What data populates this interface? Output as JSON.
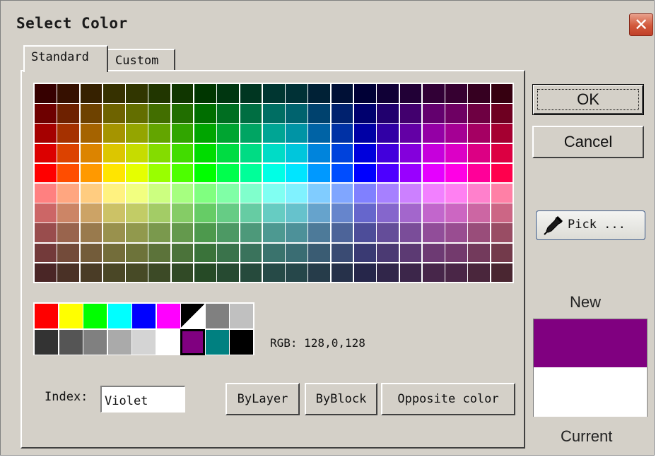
{
  "window": {
    "title": "Select Color",
    "close_glyph": "✕"
  },
  "tabs": [
    {
      "label": "Standard",
      "active": true
    },
    {
      "label": "Custom",
      "active": false
    }
  ],
  "palette": {
    "rows": [
      [
        "#360000",
        "#361000",
        "#362100",
        "#363100",
        "#313600",
        "#213600",
        "#103600",
        "#003600",
        "#003610",
        "#003621",
        "#003631",
        "#003136",
        "#002136",
        "#001036",
        "#000036",
        "#100036",
        "#210036",
        "#310036",
        "#360031",
        "#360021",
        "#360010"
      ],
      [
        "#6e0000",
        "#6e2100",
        "#6e4200",
        "#6e6300",
        "#636e00",
        "#426e00",
        "#216e00",
        "#006e00",
        "#006e21",
        "#006e42",
        "#006e63",
        "#00636e",
        "#00426e",
        "#00216e",
        "#00006e",
        "#21006e",
        "#42006e",
        "#63006e",
        "#6e0063",
        "#6e0042",
        "#6e0021"
      ],
      [
        "#a50000",
        "#a53100",
        "#a56300",
        "#a59400",
        "#94a500",
        "#63a500",
        "#31a500",
        "#00a500",
        "#00a531",
        "#00a563",
        "#00a594",
        "#0094a5",
        "#0063a5",
        "#0031a5",
        "#0000a5",
        "#3100a5",
        "#6300a5",
        "#9400a5",
        "#a50094",
        "#a50063",
        "#a50031"
      ],
      [
        "#dc0000",
        "#dc4200",
        "#dc8400",
        "#dcc600",
        "#c6dc00",
        "#84dc00",
        "#42dc00",
        "#00dc00",
        "#00dc42",
        "#00dc84",
        "#00dcc6",
        "#00c6dc",
        "#0084dc",
        "#0042dc",
        "#0000dc",
        "#4200dc",
        "#8400dc",
        "#c600dc",
        "#dc00c6",
        "#dc0084",
        "#dc0042"
      ],
      [
        "#ff0000",
        "#ff4d00",
        "#ff9900",
        "#ffe500",
        "#e5ff00",
        "#99ff00",
        "#4dff00",
        "#00ff00",
        "#00ff4d",
        "#00ff99",
        "#00ffe5",
        "#00e5ff",
        "#0099ff",
        "#004dff",
        "#0000ff",
        "#4d00ff",
        "#9900ff",
        "#e500ff",
        "#ff00e5",
        "#ff0099",
        "#ff004d"
      ],
      [
        "#ff8080",
        "#ffa680",
        "#ffcc80",
        "#fff280",
        "#f2ff80",
        "#ccff80",
        "#a6ff80",
        "#80ff80",
        "#80ffa6",
        "#80ffcc",
        "#80fff2",
        "#80f2ff",
        "#80ccff",
        "#80a6ff",
        "#8080ff",
        "#a680ff",
        "#cc80ff",
        "#f280ff",
        "#ff80f2",
        "#ff80cc",
        "#ff80a6"
      ],
      [
        "#cc6666",
        "#cc8566",
        "#cca366",
        "#ccc266",
        "#c2cc66",
        "#a3cc66",
        "#85cc66",
        "#66cc66",
        "#66cc85",
        "#66cca3",
        "#66ccc2",
        "#66c2cc",
        "#66a3cc",
        "#6685cc",
        "#6666cc",
        "#8566cc",
        "#a366cc",
        "#c266cc",
        "#cc66c2",
        "#cc66a3",
        "#cc6685"
      ],
      [
        "#994d4d",
        "#99644d",
        "#997a4d",
        "#99914d",
        "#91994d",
        "#7a994d",
        "#64994d",
        "#4d994d",
        "#4d9964",
        "#4d997a",
        "#4d9991",
        "#4d9199",
        "#4d7a99",
        "#4d6499",
        "#4d4d99",
        "#644d99",
        "#7a4d99",
        "#914d99",
        "#994d91",
        "#994d7a",
        "#994d64"
      ],
      [
        "#733a3a",
        "#734b3a",
        "#735c3a",
        "#736d3a",
        "#6d733a",
        "#5c733a",
        "#4b733a",
        "#3a733a",
        "#3a734b",
        "#3a735c",
        "#3a736d",
        "#3a6d73",
        "#3a5c73",
        "#3a4b73",
        "#3a3a73",
        "#4b3a73",
        "#5c3a73",
        "#6d3a73",
        "#733a6d",
        "#733a5c",
        "#733a4b"
      ],
      [
        "#4a2626",
        "#4a3126",
        "#4a3c26",
        "#4a4726",
        "#474a26",
        "#3c4a26",
        "#314a26",
        "#264a26",
        "#264a31",
        "#264a3c",
        "#264a47",
        "#26474a",
        "#263c4a",
        "#26314a",
        "#26264a",
        "#31264a",
        "#3c264a",
        "#47264a",
        "#4a2647",
        "#4a263c",
        "#4a2631"
      ]
    ]
  },
  "basic_colors": {
    "rows": [
      [
        "#ff0000",
        "#ffff00",
        "#00ff00",
        "#00ffff",
        "#0000ff",
        "#ff00ff",
        "bw",
        "#808080",
        "#c0c0c0"
      ],
      [
        "#333333",
        "#555555",
        "#808080",
        "#aaaaaa",
        "#d4d4d4",
        "#ffffff",
        "#800080",
        "#008080",
        "#000000"
      ]
    ],
    "selected": [
      1,
      6
    ],
    "black_white_label": "black/white"
  },
  "rgb_readout": "RGB: 128,0,128",
  "index": {
    "label": "Index:",
    "value": "Violet"
  },
  "buttons": {
    "bylayer": "ByLayer",
    "byblock": "ByBlock",
    "opposite": "Opposite color",
    "ok": "OK",
    "cancel": "Cancel",
    "pick": "Pick ..."
  },
  "preview": {
    "new_label": "New",
    "current_label": "Current",
    "new_color": "#800080",
    "current_color": "#ffffff"
  },
  "icons": {
    "close": "close-icon",
    "pick": "eyedropper-icon"
  }
}
